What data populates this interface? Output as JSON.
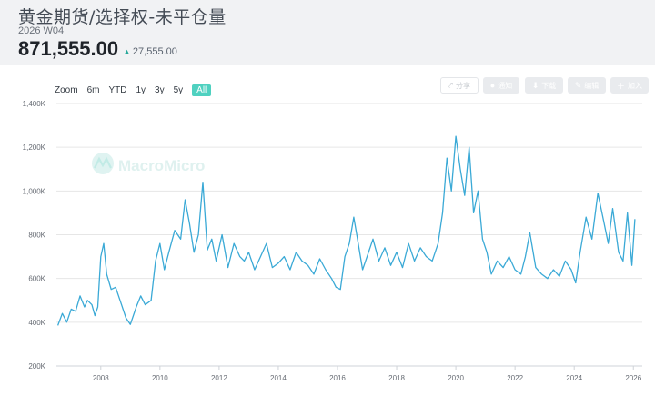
{
  "header": {
    "title": "黄金期货/选择权-未平仓量",
    "subtitle": "2026 W04",
    "value": "871,555.00",
    "change": "27,555.00"
  },
  "zoom": {
    "label": "Zoom",
    "buttons": [
      "6m",
      "YTD",
      "1y",
      "3y",
      "5y",
      "All"
    ],
    "active": "All"
  },
  "toolbar": {
    "share": "分享",
    "b2": "通知",
    "b3": "下载",
    "b4": "编辑",
    "b5": "加入"
  },
  "watermark": "MacroMicro",
  "colors": {
    "line": "#3aa9d6",
    "accent": "#4fd1c0",
    "up": "#27a89a"
  },
  "chart_data": {
    "type": "line",
    "ylim": [
      200,
      1400
    ],
    "yticks": [
      200,
      400,
      600,
      800,
      1000,
      1200,
      1400
    ],
    "ytick_labels": [
      "200K",
      "400K",
      "600K",
      "800K",
      "1,000K",
      "1,200K",
      "1,400K"
    ],
    "xlim": [
      2006.5,
      2026.3
    ],
    "xticks": [
      2008,
      2010,
      2012,
      2014,
      2016,
      2018,
      2020,
      2022,
      2024,
      2026
    ],
    "xtick_labels": [
      "2008",
      "2010",
      "2012",
      "2014",
      "2016",
      "2018",
      "2020",
      "2022",
      "2024",
      "2026"
    ],
    "grid": true,
    "series": [
      {
        "unit": "thousand",
        "x": [
          2006.55,
          2006.7,
          2006.85,
          2007.0,
          2007.15,
          2007.3,
          2007.45,
          2007.55,
          2007.7,
          2007.8,
          2007.9,
          2008.0,
          2008.1,
          2008.2,
          2008.35,
          2008.5,
          2008.7,
          2008.85,
          2009.0,
          2009.2,
          2009.35,
          2009.5,
          2009.7,
          2009.85,
          2010.0,
          2010.15,
          2010.3,
          2010.5,
          2010.7,
          2010.85,
          2011.0,
          2011.15,
          2011.3,
          2011.45,
          2011.6,
          2011.75,
          2011.9,
          2012.1,
          2012.3,
          2012.5,
          2012.7,
          2012.85,
          2013.0,
          2013.2,
          2013.4,
          2013.6,
          2013.8,
          2014.0,
          2014.2,
          2014.4,
          2014.6,
          2014.8,
          2015.0,
          2015.2,
          2015.4,
          2015.6,
          2015.8,
          2015.95,
          2016.1,
          2016.25,
          2016.4,
          2016.55,
          2016.7,
          2016.85,
          2017.0,
          2017.2,
          2017.4,
          2017.6,
          2017.8,
          2018.0,
          2018.2,
          2018.4,
          2018.6,
          2018.8,
          2019.0,
          2019.2,
          2019.4,
          2019.55,
          2019.7,
          2019.85,
          2020.0,
          2020.15,
          2020.3,
          2020.45,
          2020.6,
          2020.75,
          2020.9,
          2021.05,
          2021.2,
          2021.4,
          2021.6,
          2021.8,
          2022.0,
          2022.2,
          2022.35,
          2022.5,
          2022.7,
          2022.9,
          2023.1,
          2023.3,
          2023.5,
          2023.7,
          2023.9,
          2024.05,
          2024.2,
          2024.4,
          2024.6,
          2024.8,
          2025.0,
          2025.15,
          2025.3,
          2025.5,
          2025.65,
          2025.8,
          2025.95,
          2026.05
        ],
        "values": [
          385,
          440,
          400,
          460,
          450,
          520,
          470,
          500,
          480,
          430,
          470,
          700,
          760,
          620,
          550,
          560,
          480,
          420,
          390,
          470,
          520,
          480,
          500,
          680,
          760,
          640,
          720,
          820,
          780,
          960,
          850,
          720,
          800,
          1040,
          730,
          780,
          680,
          800,
          650,
          760,
          700,
          680,
          720,
          640,
          700,
          760,
          650,
          670,
          700,
          640,
          720,
          680,
          660,
          620,
          690,
          640,
          600,
          560,
          550,
          700,
          760,
          880,
          760,
          640,
          700,
          780,
          680,
          740,
          660,
          720,
          650,
          760,
          680,
          740,
          700,
          680,
          760,
          900,
          1150,
          1000,
          1250,
          1100,
          980,
          1200,
          900,
          1000,
          780,
          720,
          620,
          680,
          650,
          700,
          640,
          620,
          700,
          810,
          650,
          620,
          600,
          640,
          610,
          680,
          640,
          580,
          720,
          880,
          780,
          990,
          860,
          760,
          920,
          720,
          680,
          900,
          660,
          871.555
        ]
      }
    ]
  }
}
